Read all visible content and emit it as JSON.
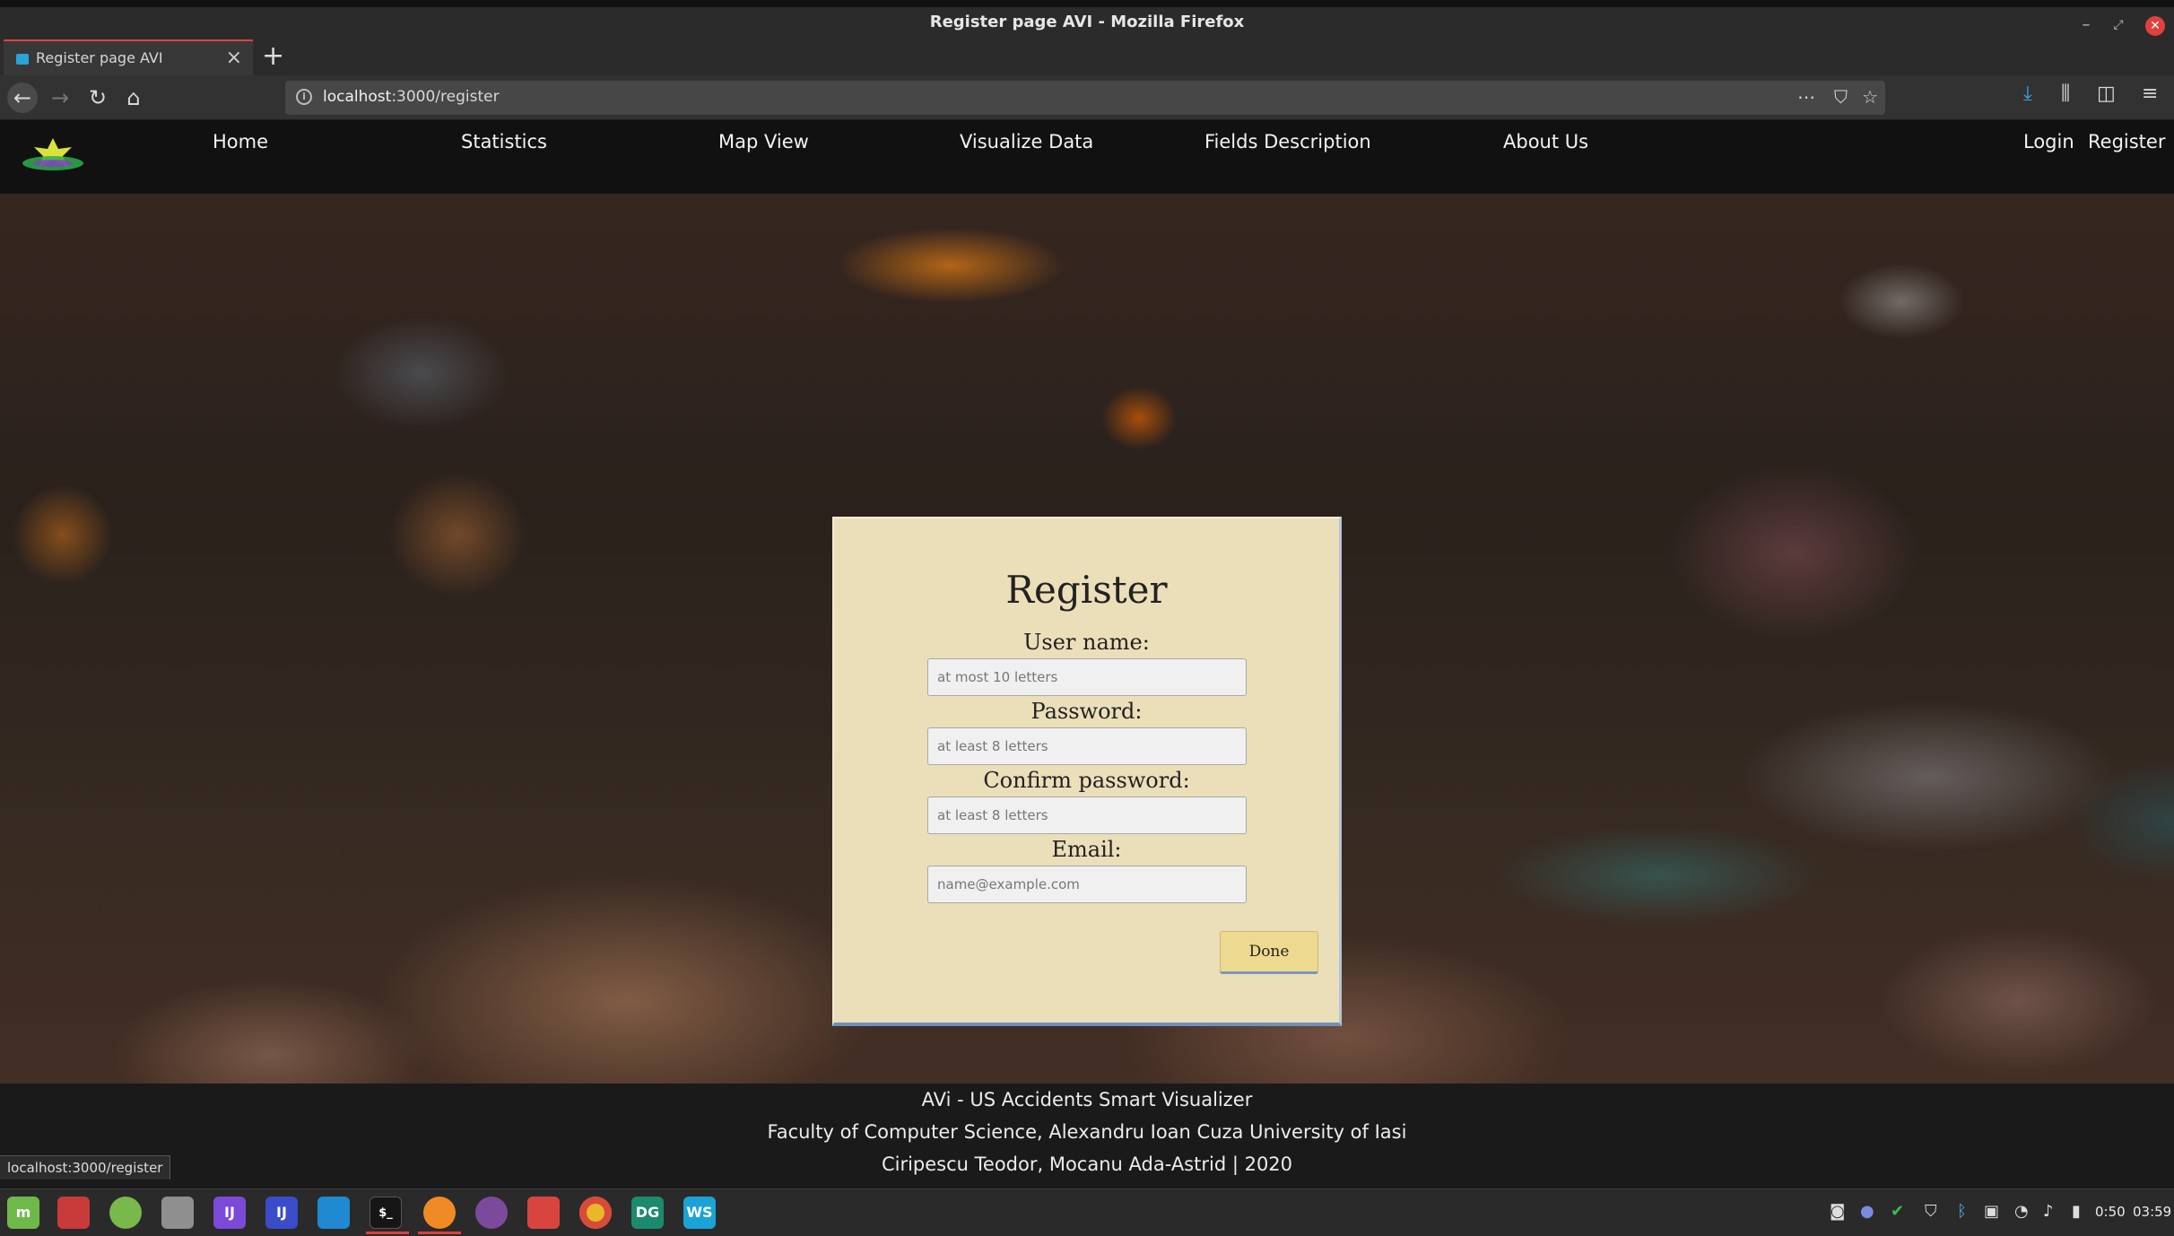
{
  "window": {
    "title": "Register page AVI - Mozilla Firefox"
  },
  "tab": {
    "title": "Register page AVI"
  },
  "browser": {
    "url_host": "localhost",
    "url_path": ":3000/register",
    "status_url": "localhost:3000/register"
  },
  "nav": {
    "items": [
      "Home",
      "Statistics",
      "Map View",
      "Visualize Data",
      "Fields Description",
      "About Us"
    ],
    "login": "Login",
    "register": "Register"
  },
  "form": {
    "title": "Register",
    "username_label": "User name:",
    "username_placeholder": "at most 10 letters",
    "password_label": "Password:",
    "password_placeholder": "at least 8 letters",
    "confirm_label": "Confirm password:",
    "confirm_placeholder": "at least 8 letters",
    "email_label": "Email:",
    "email_placeholder": "name@example.com",
    "submit": "Done"
  },
  "footer": {
    "line1": "AVi - US Accidents Smart Visualizer",
    "line2": "Faculty of Computer Science, Alexandru Ioan Cuza University of Iasi",
    "line3": "Ciripescu Teodor, Mocanu Ada-Astrid | 2020"
  },
  "taskbar": {
    "apps": [
      {
        "name": "linux-mint-menu",
        "glyph": "m",
        "color": "#6fb84a"
      },
      {
        "name": "files",
        "glyph": "",
        "color": "#d23b3b"
      },
      {
        "name": "calculator",
        "glyph": "",
        "color": "#79b84a"
      },
      {
        "name": "settings",
        "glyph": "",
        "color": "#8f8f8f"
      },
      {
        "name": "intellij",
        "glyph": "IJ",
        "color": "#7b4ad8"
      },
      {
        "name": "intellij-2",
        "glyph": "IJ",
        "color": "#3a4cc9"
      },
      {
        "name": "vscode",
        "glyph": "",
        "color": "#1f8ad2"
      },
      {
        "name": "terminal",
        "glyph": "$_",
        "color": "#202020"
      },
      {
        "name": "firefox",
        "glyph": "",
        "color": "#f08a24"
      },
      {
        "name": "github",
        "glyph": "",
        "color": "#7c4a9c"
      },
      {
        "name": "folder",
        "glyph": "",
        "color": "#d9443f"
      },
      {
        "name": "chrome",
        "glyph": "",
        "color": "#e8b72a"
      },
      {
        "name": "datagrip",
        "glyph": "DG",
        "color": "#1c8a6d"
      },
      {
        "name": "webstorm",
        "glyph": "WS",
        "color": "#1ba3d6"
      }
    ],
    "battery_time": "0:50",
    "clock": "03:59"
  }
}
